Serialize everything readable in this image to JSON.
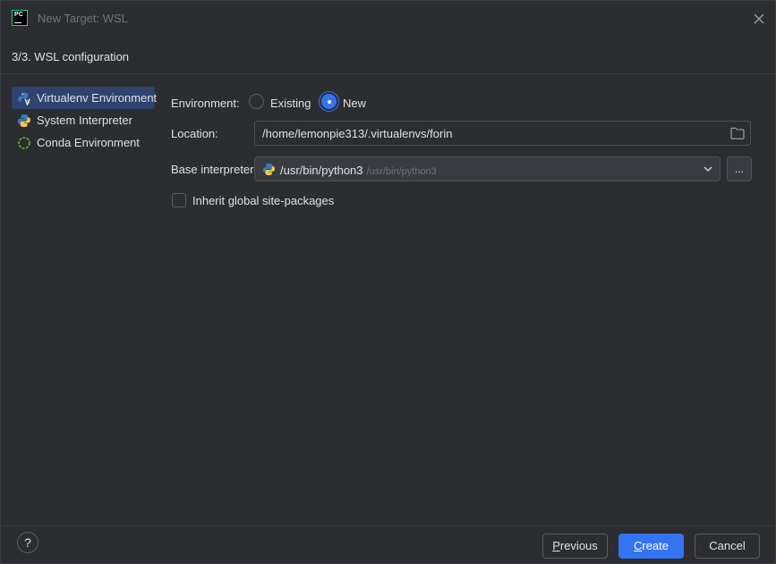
{
  "window": {
    "title": "New Target: WSL",
    "close_icon": "close-icon"
  },
  "step": {
    "title": "3/3. WSL configuration"
  },
  "sidebar": {
    "items": [
      {
        "label": "Virtualenv Environment",
        "icon": "virtualenv-icon",
        "selected": true
      },
      {
        "label": "System Interpreter",
        "icon": "python-icon",
        "selected": false
      },
      {
        "label": "Conda Environment",
        "icon": "conda-icon",
        "selected": false
      }
    ]
  },
  "form": {
    "environment_label": "Environment:",
    "environment_options": [
      {
        "label": "Existing",
        "checked": false
      },
      {
        "label": "New",
        "checked": true
      }
    ],
    "location_label": "Location:",
    "location_value": "/home/lemonpie313/.virtualenvs/forin",
    "base_interpreter_label": "Base interpreter:",
    "base_interpreter_value": "/usr/bin/python3",
    "base_interpreter_path_hint": "/usr/bin/python3",
    "browse_label": "...",
    "inherit_label": "Inherit global site-packages",
    "inherit_checked": false
  },
  "footer": {
    "help_label": "?",
    "previous_mnemonic": "P",
    "previous_rest": "revious",
    "create_mnemonic": "C",
    "create_rest": "reate",
    "cancel_label": "Cancel"
  },
  "colors": {
    "accent": "#3574f0",
    "background": "#2b2d30",
    "selected_row": "#2e436e"
  }
}
